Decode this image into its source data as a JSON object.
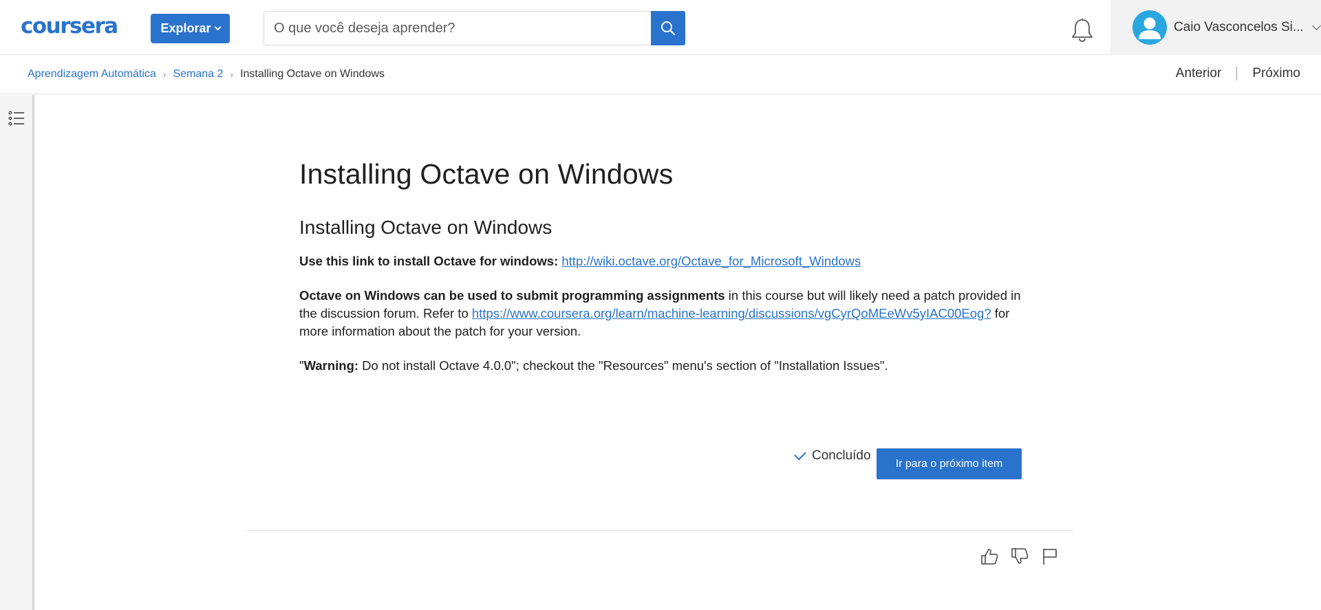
{
  "header": {
    "logo": "coursera",
    "explore_label": "Explorar",
    "search_placeholder": "O que você deseja aprender?",
    "user_name": "Caio Vasconcelos Si...",
    "icons": {
      "search": "search-icon",
      "bell": "bell-icon",
      "avatar": "user-avatar-icon",
      "menu": "chevron-down-icon"
    }
  },
  "breadcrumb": {
    "items": [
      "Aprendizagem Automática",
      "Semana 2"
    ],
    "current": "Installing Octave on Windows",
    "separator": "›"
  },
  "nav": {
    "previous": "Anterior",
    "next": "Próximo"
  },
  "content": {
    "title": "Installing Octave on Windows",
    "subtitle": "Installing Octave on Windows",
    "p1_bold": "Use this link to install Octave for windows:",
    "p1_link": "http://wiki.octave.org/Octave_for_Microsoft_Windows",
    "p2_bold": "Octave on Windows can be used to submit programming assignments",
    "p2_text": " in this course but will likely need a patch provided in the discussion forum. Refer to ",
    "p2_link": "https://www.coursera.org/learn/machine-learning/discussions/vgCyrQoMEeWv5yIAC00Eog?",
    "p2_tail": " for more information about the patch for your version.",
    "p3_quote": "\"",
    "p3_bold": "Warning:",
    "p3_text": " Do not install Octave 4.0.0\"; checkout the \"Resources\" menu's section of \"Installation Issues\"."
  },
  "actions": {
    "done_label": "Concluído",
    "next_item_label": "Ir para o próximo item"
  },
  "feedback": {
    "icons": [
      "thumbs-up-icon",
      "thumbs-down-icon",
      "flag-icon"
    ]
  },
  "colors": {
    "accent": "#2a73cc",
    "avatar": "#29a7de"
  }
}
